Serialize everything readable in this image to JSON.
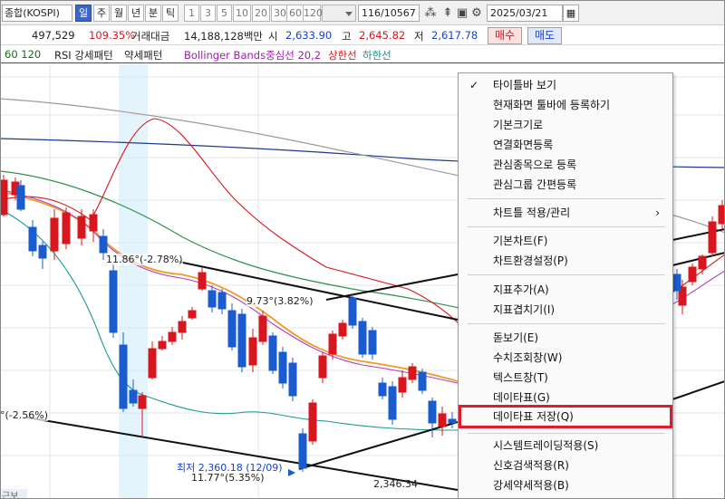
{
  "toolbar": {
    "symbol": "종합(KOSPI)",
    "periods": [
      "일",
      "주",
      "월",
      "년",
      "분",
      "틱"
    ],
    "active_period": "일",
    "intervals": [
      "1",
      "3",
      "5",
      "10",
      "20",
      "30",
      "60",
      "120"
    ],
    "count_value": "116",
    "count_total": "/10567",
    "date": "2025/03/21",
    "icons": [
      "crosshair-icon",
      "chart-settings-icon",
      "save-icon",
      "gear-icon",
      "calendar-icon"
    ]
  },
  "quote": {
    "price": "497,529",
    "change_pct": "109.35%",
    "volume_label": "거래대금",
    "volume_value": "14,188,128백만",
    "open_label": "시",
    "open_value": "2,633.90",
    "high_label": "고",
    "high_value": "2,645.82",
    "low_label": "저",
    "low_value": "2,617.78",
    "buy_label": "매수",
    "sell_label": "매도"
  },
  "legend": {
    "ma_tail": "60  120",
    "rsi_strong": "RSI 강세패턴",
    "rsi_weak": "약세패턴",
    "bollinger": "Bollinger Bands중심선 20,2",
    "upper": "상한선",
    "lower": "하한선"
  },
  "annotations": {
    "a1": "11.86°(-2.78%)",
    "a2": "9.73°(3.82%)",
    "a3": "°(-2.56%)",
    "low_marker": "최저 2,360.18 (12/09)",
    "a4": "11.77°(5.35%)",
    "level": "2,346.34",
    "bottom_label": "근보"
  },
  "context_menu": {
    "items": [
      {
        "label": "타이틀바 보기",
        "checked": true
      },
      {
        "label": "현재화면 툴바에 등록하기"
      },
      {
        "label": "기본크기로"
      },
      {
        "label": "연결화면등록"
      },
      {
        "label": "관심종목으로 등록"
      },
      {
        "label": "관심그룹 간편등록"
      },
      {
        "label": "차트틀 적용/관리",
        "submenu": true
      },
      {
        "label": "기본차트(F)"
      },
      {
        "label": "차트환경설정(P)"
      },
      {
        "label": "지표추가(A)"
      },
      {
        "label": "지표겹치기(I)"
      },
      {
        "label": "돋보기(E)"
      },
      {
        "label": "수치조회창(W)"
      },
      {
        "label": "텍스트창(T)"
      },
      {
        "label": "데이타표(G)"
      },
      {
        "label": "데이타표 저장(Q)",
        "highlighted": true
      },
      {
        "label": "시스템트레이딩적용(S)"
      },
      {
        "label": "신호검색적용(R)"
      },
      {
        "label": "강세약세적용(B)"
      }
    ],
    "highlight_color": "#e21b2a"
  },
  "colors": {
    "up": "#d8161d",
    "down": "#1a5bd0",
    "active": "#3b66c7"
  }
}
